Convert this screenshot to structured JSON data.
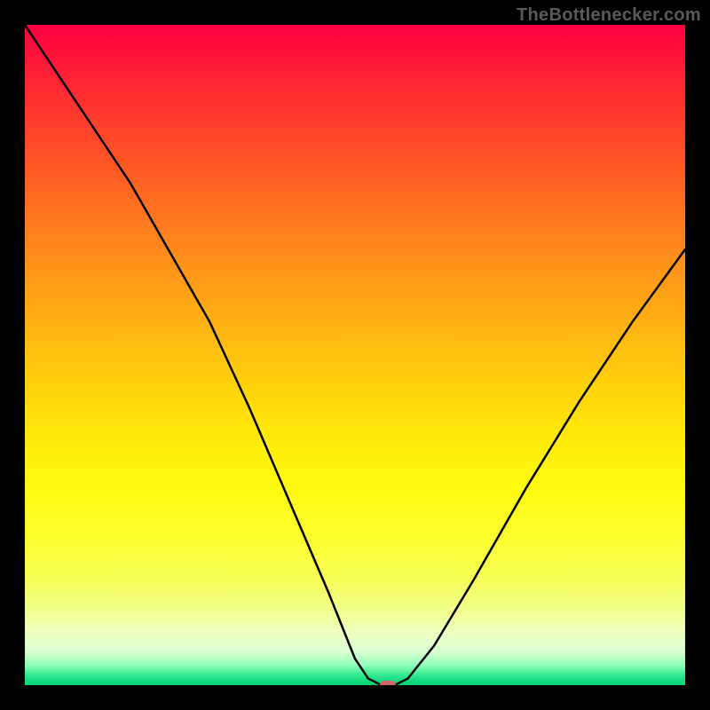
{
  "watermark": {
    "text": "TheBottlenecker.com"
  },
  "chart_data": {
    "type": "line",
    "title": "",
    "xlabel": "",
    "ylabel": "",
    "xlim": [
      0,
      100
    ],
    "ylim": [
      0,
      100
    ],
    "grid": false,
    "legend": false,
    "series": [
      {
        "name": "bottleneck-curve",
        "x": [
          0,
          8,
          16,
          24,
          28,
          34,
          40,
          46,
          50,
          52,
          54,
          56,
          58,
          62,
          68,
          76,
          84,
          92,
          100
        ],
        "values": [
          100,
          88,
          76,
          62,
          55,
          42,
          28,
          14,
          4,
          1,
          0,
          0,
          1,
          6,
          16,
          30,
          43,
          55,
          66
        ]
      }
    ],
    "marker": {
      "x": 55,
      "y": 0,
      "color": "#d06868"
    },
    "background_gradient": {
      "direction": "vertical",
      "stops": [
        {
          "pos": 0,
          "color": "#ff0040"
        },
        {
          "pos": 0.3,
          "color": "#ff7a1e"
        },
        {
          "pos": 0.62,
          "color": "#ffe808"
        },
        {
          "pos": 0.9,
          "color": "#edffc0"
        },
        {
          "pos": 1.0,
          "color": "#00d070"
        }
      ]
    }
  }
}
